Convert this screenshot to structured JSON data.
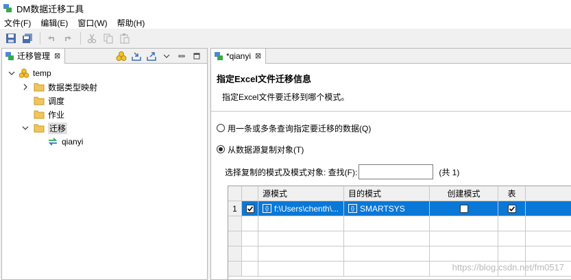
{
  "window": {
    "title": "DM数据迁移工具"
  },
  "menu": [
    "文件(F)",
    "编辑(E)",
    "窗口(W)",
    "帮助(H)"
  ],
  "left_view": {
    "tab_label": "迁移管理",
    "close_glyph": "⊠",
    "tree": {
      "root": "temp",
      "children": [
        "数据类型映射",
        "调度",
        "作业",
        "迁移"
      ],
      "grandchild": "qianyi"
    }
  },
  "editor": {
    "tab_label": "*qianyi",
    "close_glyph": "⊠",
    "header_title": "指定Excel文件迁移信息",
    "header_desc": "指定Excel文件要迁移到哪个模式。",
    "option_query": "用一条或多条查询指定要迁移的数据(Q)",
    "option_copy": "从数据源复制对象(T)",
    "search_label": "选择复制的模式及模式对象:  查找(F):",
    "search_value": "",
    "count_text": "(共 1)",
    "grid": {
      "headers": [
        "源模式",
        "目的模式",
        "创建模式",
        "表"
      ],
      "row_number": "1",
      "row": {
        "source": "f:\\Users\\chenth\\...",
        "target": "SMARTSYS",
        "create_checked": false,
        "table_checked": true,
        "selected_checked": true
      }
    }
  },
  "watermark": "https://blog.csdn.net/fm0517",
  "colors": {
    "selection": "#0a78d7",
    "folder": "#f0c65c"
  }
}
